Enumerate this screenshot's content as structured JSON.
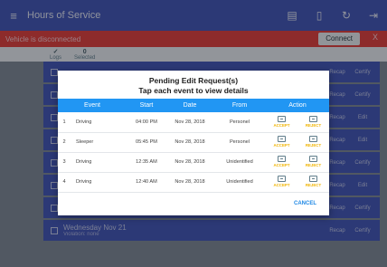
{
  "appbar": {
    "title": "Hours of Service",
    "icons": [
      "chat-icon",
      "device-icon",
      "refresh-icon",
      "logout-icon"
    ]
  },
  "warning": {
    "message": "Vehicle is disconnected",
    "connect_label": "Connect",
    "close_label": "X"
  },
  "stats": [
    {
      "value": "",
      "label": "Logs"
    },
    {
      "value": "0",
      "label": "Selected"
    }
  ],
  "background_rows": [
    {
      "title": "",
      "sub": "",
      "acts": [
        "Recap",
        "Certify"
      ]
    },
    {
      "title": "",
      "sub": "",
      "acts": [
        "Recap",
        "Certify"
      ]
    },
    {
      "title": "",
      "sub": "",
      "acts": [
        "Recap",
        "Edit"
      ]
    },
    {
      "title": "",
      "sub": "",
      "acts": [
        "Recap",
        "Edit"
      ]
    },
    {
      "title": "",
      "sub": "",
      "acts": [
        "Recap",
        "Certify"
      ]
    },
    {
      "title": "",
      "sub": "",
      "acts": [
        "Recap",
        "Edit"
      ]
    },
    {
      "title": "",
      "sub": "",
      "acts": [
        "Recap",
        "Certify"
      ]
    },
    {
      "title": "Wednesday Nov 21",
      "sub": "Violation: none",
      "acts": [
        "Recap",
        "Certify"
      ]
    }
  ],
  "dialog": {
    "title_line1": "Pending Edit Request(s)",
    "title_line2": "Tap each event to view details",
    "columns": [
      "Event",
      "Start",
      "Date",
      "From",
      "Action"
    ],
    "rows": [
      {
        "index": "1",
        "event": "Driving",
        "start": "04:00 PM",
        "date": "Nov 28, 2018",
        "from": "Personel"
      },
      {
        "index": "2",
        "event": "Sleeper",
        "start": "05:45 PM",
        "date": "Nov 28, 2018",
        "from": "Personel"
      },
      {
        "index": "3",
        "event": "Driving",
        "start": "12:35 AM",
        "date": "Nov 28, 2018",
        "from": "Unidentified"
      },
      {
        "index": "4",
        "event": "Driving",
        "start": "12:40 AM",
        "date": "Nov 28, 2018",
        "from": "Unidentified"
      }
    ],
    "accept_label": "ACCEPT",
    "reject_label": "REJECT",
    "cancel_label": "CANCEL"
  }
}
